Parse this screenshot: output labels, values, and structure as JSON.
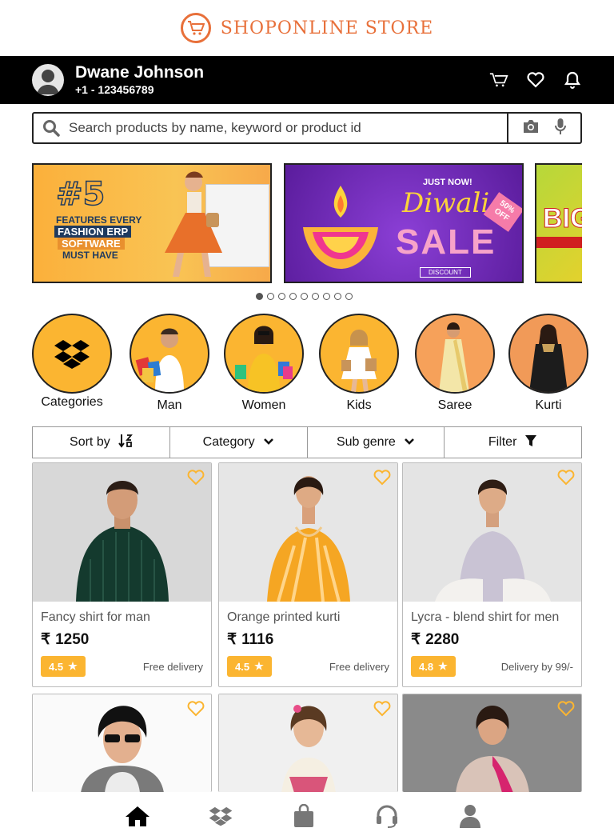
{
  "store": {
    "name": "SHOPONLINE STORE",
    "brand_color": "#e8703a"
  },
  "user": {
    "name": "Dwane Johnson",
    "phone": "+1 - 123456789"
  },
  "header_icons": [
    "cart-icon",
    "heart-icon",
    "bell-icon"
  ],
  "search": {
    "placeholder": "Search products by name, keyword or product id",
    "value": ""
  },
  "banners": [
    {
      "badge": "#5",
      "line1": "FEATURES EVERY",
      "line2": "FASHION ERP",
      "line3": "SOFTWARE",
      "line4": "MUST HAVE"
    },
    {
      "tagline": "JUST NOW!",
      "title": "Diwali",
      "subtitle": "SALE",
      "tag": "50% OFF",
      "button": "DISCOUNT"
    },
    {
      "title": "BIG"
    }
  ],
  "carousel": {
    "total_dots": 9,
    "active_index": 0
  },
  "categories": [
    {
      "label": "Categories"
    },
    {
      "label": "Man"
    },
    {
      "label": "Women"
    },
    {
      "label": "Kids"
    },
    {
      "label": "Saree"
    },
    {
      "label": "Kurti"
    }
  ],
  "filterbar": {
    "sort": "Sort by",
    "category": "Category",
    "subgenre": "Sub genre",
    "filter": "Filter"
  },
  "products": [
    {
      "title": "Fancy shirt for man",
      "currency": "₹",
      "price": "1250",
      "rating": "4.5",
      "delivery": "Free delivery"
    },
    {
      "title": "Orange printed kurti",
      "currency": "₹",
      "price": "1116",
      "rating": "4.5",
      "delivery": "Free delivery"
    },
    {
      "title": "Lycra - blend shirt for men",
      "currency": "₹",
      "price": "2280",
      "rating": "4.8",
      "delivery": "Delivery by 99/-"
    }
  ],
  "colors": {
    "accent": "#fbb531",
    "header_bg": "#000000"
  },
  "bottom_nav": [
    "home-icon",
    "dropbox-icon",
    "bag-icon",
    "headset-icon",
    "user-icon"
  ]
}
